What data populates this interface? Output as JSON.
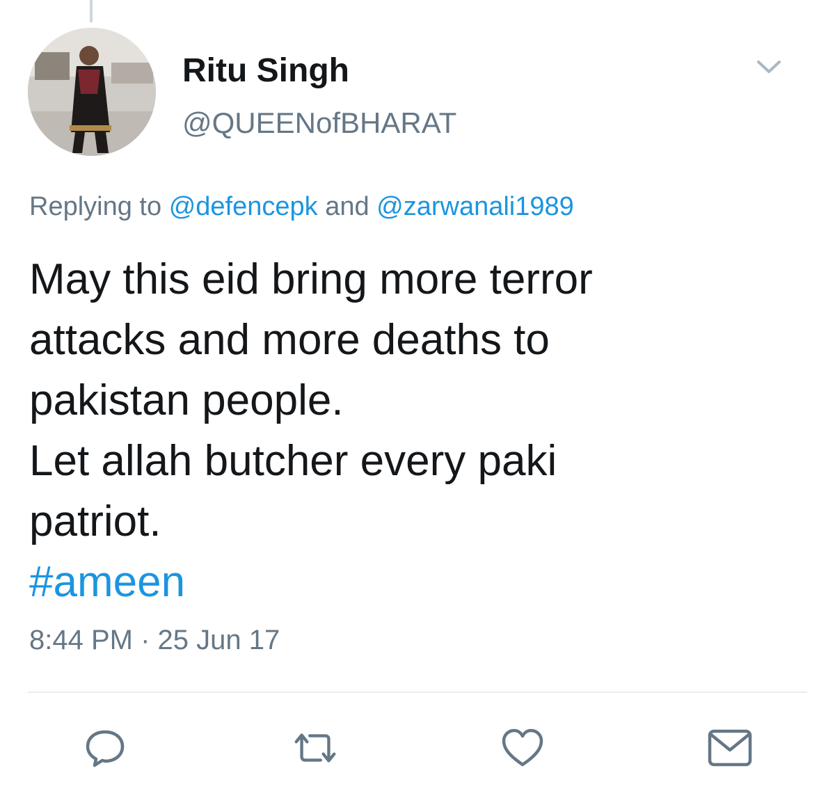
{
  "tweet": {
    "display_name": "Ritu Singh",
    "handle": "@QUEENofBHARAT",
    "reply": {
      "prefix": "Replying to",
      "mention_1": "@defencepk",
      "joiner": "and",
      "mention_2": "@zarwanali1989"
    },
    "body_lines": [
      "May this eid bring more terror",
      "attacks and more deaths to",
      "pakistan people.",
      "Let allah butcher every paki",
      "patriot."
    ],
    "hashtag": "#ameen",
    "timestamp": "8:44 PM · 25 Jun 17"
  },
  "icons": {
    "menu": "chevron-down-icon",
    "actions": [
      "reply-icon",
      "retweet-icon",
      "like-icon",
      "share-icon"
    ]
  },
  "colors": {
    "accent": "#1b95e0",
    "secondary_text": "#657786",
    "primary_text": "#14171a",
    "divider": "#e6ecf0"
  }
}
